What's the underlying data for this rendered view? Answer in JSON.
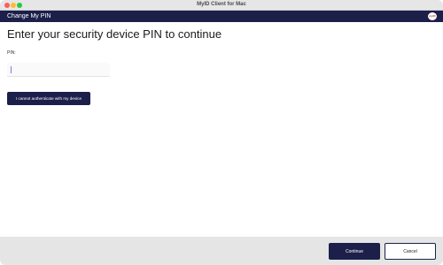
{
  "window": {
    "title": "MyID Client for Mac"
  },
  "appbar": {
    "title": "Change My PIN",
    "logo_text": "myID"
  },
  "main": {
    "heading": "Enter your security device PIN to continue",
    "pin_label": "PIN:",
    "pin_value": "",
    "cannot_auth_label": "I cannot authenticate with my device"
  },
  "footer": {
    "continue_label": "Continue",
    "cancel_label": "Cancel"
  },
  "colors": {
    "brand": "#1c1f4a",
    "footer_bg": "#e5e5e5"
  },
  "icons": {
    "close": "close-icon",
    "minimize": "minimize-icon",
    "maximize": "maximize-icon",
    "logo": "myid-logo-icon"
  }
}
